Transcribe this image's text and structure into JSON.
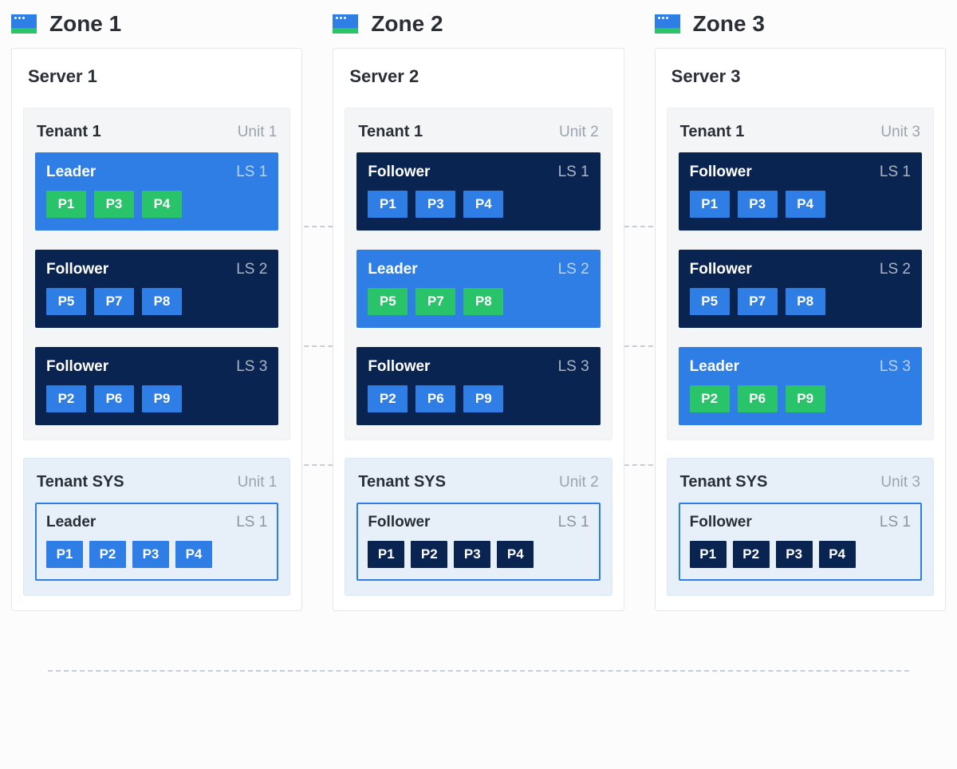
{
  "zones": [
    {
      "title": "Zone 1",
      "server": "Server 1",
      "tenants": [
        {
          "name": "Tenant 1",
          "unit": "Unit 1",
          "sys": false,
          "streams": [
            {
              "role": "Leader",
              "id": "LS 1",
              "leader": true,
              "pillColor": "green",
              "p": [
                "P1",
                "P3",
                "P4"
              ]
            },
            {
              "role": "Follower",
              "id": "LS 2",
              "leader": false,
              "pillColor": "blue",
              "p": [
                "P5",
                "P7",
                "P8"
              ]
            },
            {
              "role": "Follower",
              "id": "LS 3",
              "leader": false,
              "pillColor": "blue",
              "p": [
                "P2",
                "P6",
                "P9"
              ]
            }
          ]
        },
        {
          "name": "Tenant SYS",
          "unit": "Unit 1",
          "sys": true,
          "streams": [
            {
              "role": "Leader",
              "id": "LS 1",
              "leader": true,
              "sys": true,
              "pillColor": "blue",
              "p": [
                "P1",
                "P2",
                "P3",
                "P4"
              ]
            }
          ]
        }
      ]
    },
    {
      "title": "Zone 2",
      "server": "Server 2",
      "tenants": [
        {
          "name": "Tenant 1",
          "unit": "Unit 2",
          "sys": false,
          "streams": [
            {
              "role": "Follower",
              "id": "LS 1",
              "leader": false,
              "pillColor": "blue",
              "p": [
                "P1",
                "P3",
                "P4"
              ]
            },
            {
              "role": "Leader",
              "id": "LS 2",
              "leader": true,
              "pillColor": "green",
              "p": [
                "P5",
                "P7",
                "P8"
              ]
            },
            {
              "role": "Follower",
              "id": "LS 3",
              "leader": false,
              "pillColor": "blue",
              "p": [
                "P2",
                "P6",
                "P9"
              ]
            }
          ]
        },
        {
          "name": "Tenant SYS",
          "unit": "Unit 2",
          "sys": true,
          "streams": [
            {
              "role": "Follower",
              "id": "LS 1",
              "leader": false,
              "sys": true,
              "pillColor": "dark",
              "p": [
                "P1",
                "P2",
                "P3",
                "P4"
              ]
            }
          ]
        }
      ]
    },
    {
      "title": "Zone 3",
      "server": "Server 3",
      "tenants": [
        {
          "name": "Tenant 1",
          "unit": "Unit 3",
          "sys": false,
          "streams": [
            {
              "role": "Follower",
              "id": "LS 1",
              "leader": false,
              "pillColor": "blue",
              "p": [
                "P1",
                "P3",
                "P4"
              ]
            },
            {
              "role": "Follower",
              "id": "LS 2",
              "leader": false,
              "pillColor": "blue",
              "p": [
                "P5",
                "P7",
                "P8"
              ]
            },
            {
              "role": "Leader",
              "id": "LS 3",
              "leader": true,
              "pillColor": "green",
              "p": [
                "P2",
                "P6",
                "P9"
              ]
            }
          ]
        },
        {
          "name": "Tenant SYS",
          "unit": "Unit 3",
          "sys": true,
          "streams": [
            {
              "role": "Follower",
              "id": "LS 1",
              "leader": false,
              "sys": true,
              "pillColor": "dark",
              "p": [
                "P1",
                "P2",
                "P3",
                "P4"
              ]
            }
          ]
        }
      ]
    }
  ],
  "hlines": [
    283,
    433,
    582,
    840
  ]
}
